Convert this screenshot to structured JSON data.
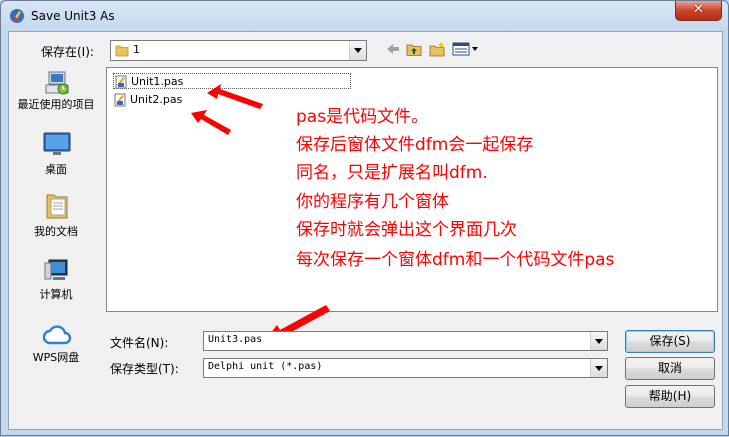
{
  "window": {
    "title": "Save Unit3 As",
    "close_label": "✕"
  },
  "save_in": {
    "label": "保存在(I):",
    "value": "1"
  },
  "toolbar": {
    "back": "back-icon",
    "up": "up-folder-icon",
    "new_folder": "new-folder-icon",
    "view_menu": "view-menu-icon"
  },
  "places": [
    {
      "label": "最近使用的项目",
      "icon": "recent-items-icon"
    },
    {
      "label": "桌面",
      "icon": "desktop-icon"
    },
    {
      "label": "我的文档",
      "icon": "documents-icon"
    },
    {
      "label": "计算机",
      "icon": "computer-icon"
    },
    {
      "label": "WPS网盘",
      "icon": "wps-cloud-icon"
    }
  ],
  "files": [
    {
      "name": "Unit1.pas",
      "selected": true
    },
    {
      "name": "Unit2.pas",
      "selected": false
    }
  ],
  "annotation": {
    "lines": [
      "pas是代码文件。",
      "保存后窗体文件dfm会一起保存",
      "同名，只是扩展名叫dfm.",
      "你的程序有几个窗体",
      "保存时就会弹出这个界面几次",
      "每次保存一个窗体dfm和一个代码文件pas"
    ],
    "color": "#ff0000"
  },
  "filename": {
    "label": "文件名(N):",
    "value": "Unit3.pas"
  },
  "filetype": {
    "label": "保存类型(T):",
    "value": "Delphi unit (*.pas)"
  },
  "buttons": {
    "save": "保存(S)",
    "cancel": "取消",
    "help": "帮助(H)"
  }
}
